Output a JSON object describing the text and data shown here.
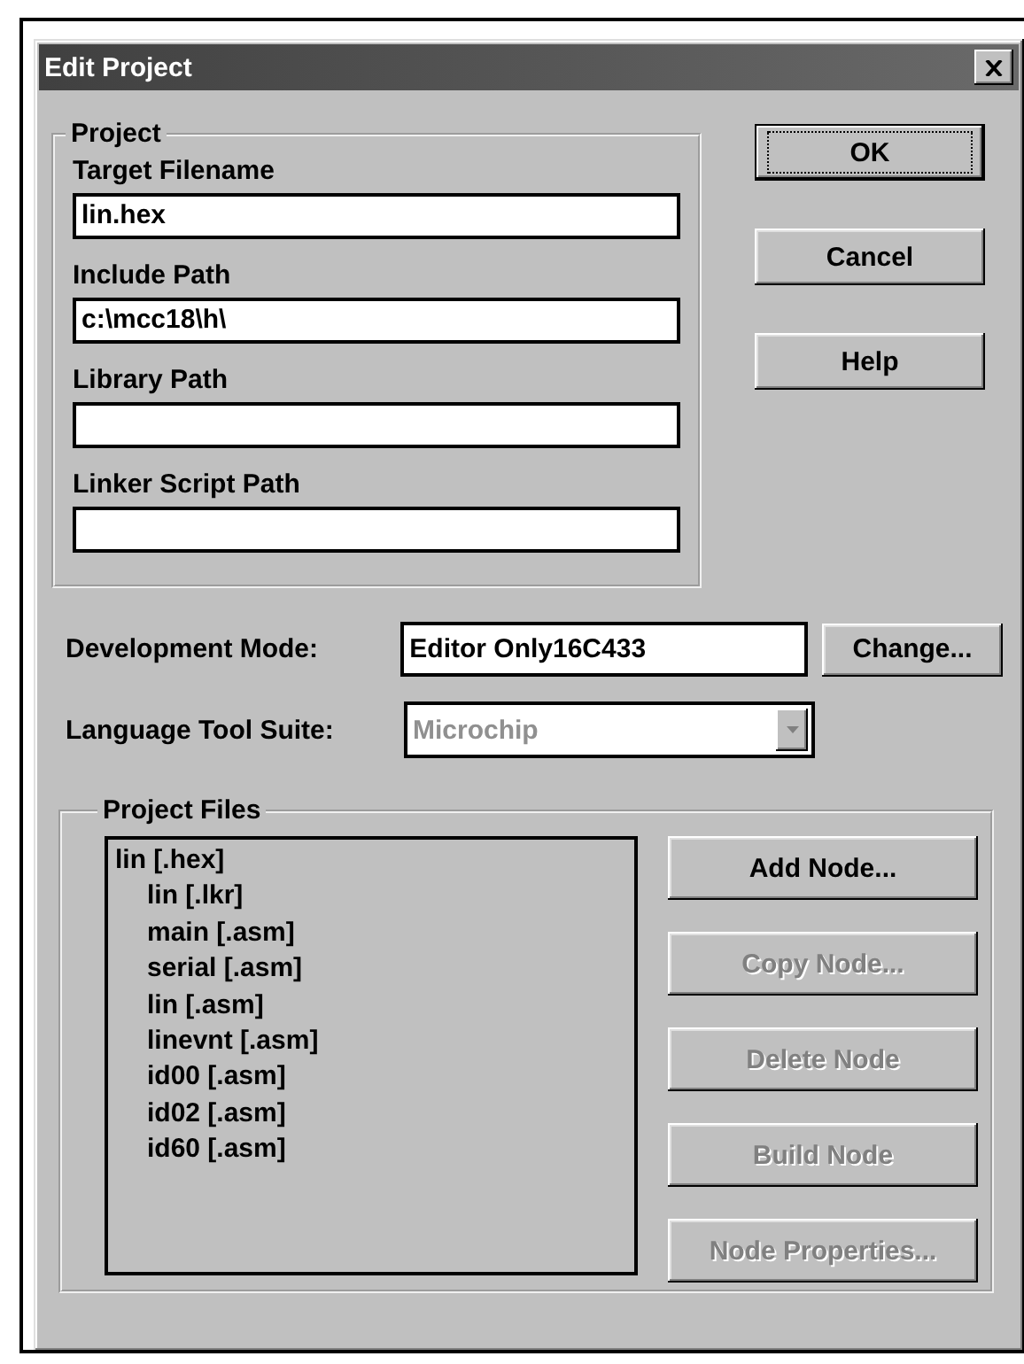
{
  "dialog": {
    "title": "Edit Project",
    "project": {
      "label": "Project",
      "fields": [
        {
          "label": "Target Filename",
          "value": "lin.hex"
        },
        {
          "label": "Include Path",
          "value": "c:\\mcc18\\h\\"
        },
        {
          "label": "Library Path"
        },
        {
          "label": "Linker Script Path"
        }
      ]
    },
    "buttons": [
      {
        "label": "OK",
        "default": true
      },
      {
        "label": "Cancel",
        "default": false
      },
      {
        "label": "Help",
        "default": false
      }
    ],
    "development_mode": {
      "label": "Development Mode:",
      "value": "Editor Only16C433",
      "button": "Change..."
    },
    "language_tool_suite": {
      "label": "Language Tool Suite:",
      "value": "Microchip",
      "disabled": true
    },
    "project_files": {
      "label": "Project Files",
      "tree": [
        {
          "label": "lin [.hex]",
          "children": [
            {
              "label": "lin [.lkr]"
            },
            {
              "label": "main [.asm]"
            },
            {
              "label": "serial [.asm]"
            },
            {
              "label": "lin [.asm]"
            },
            {
              "label": "linevnt [.asm]"
            },
            {
              "label": "id00 [.asm]"
            },
            {
              "label": "id02 [.asm]"
            },
            {
              "label": "id60 [.asm]"
            }
          ]
        }
      ],
      "buttons": [
        {
          "label": "Add Node...",
          "disabled": false
        },
        {
          "label": "Copy Node...",
          "disabled": true
        },
        {
          "label": "Delete Node",
          "disabled": true
        },
        {
          "label": "Build Node",
          "disabled": true
        },
        {
          "label": "Node Properties...",
          "disabled": true
        }
      ]
    }
  }
}
